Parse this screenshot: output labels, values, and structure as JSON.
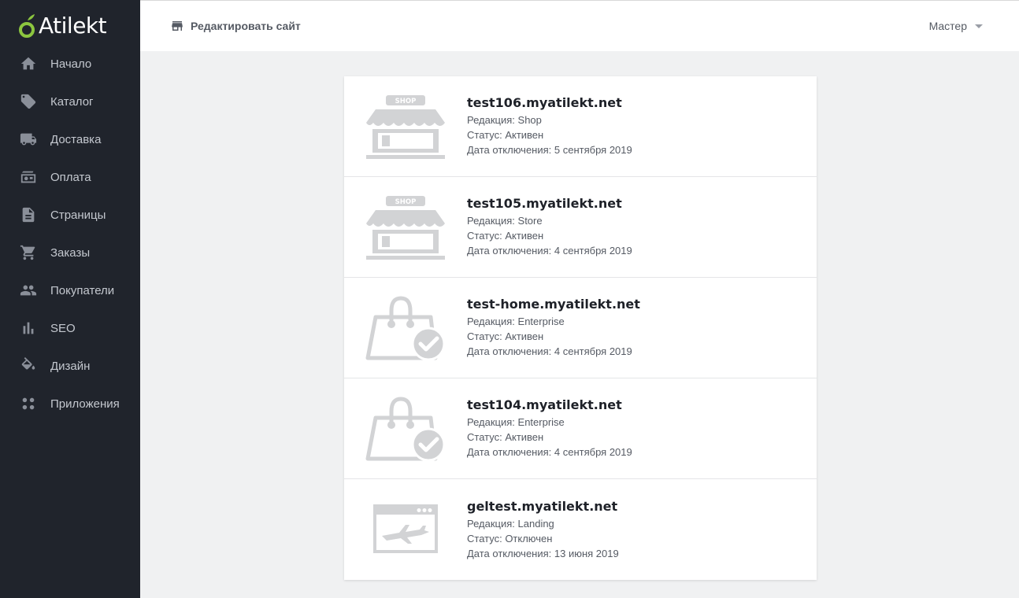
{
  "brand": {
    "name": "Atilekt"
  },
  "sidebar": {
    "items": [
      {
        "label": "Начало",
        "icon": "home-icon"
      },
      {
        "label": "Каталог",
        "icon": "tag-icon"
      },
      {
        "label": "Доставка",
        "icon": "truck-icon"
      },
      {
        "label": "Оплата",
        "icon": "wallet-icon"
      },
      {
        "label": "Страницы",
        "icon": "document-icon"
      },
      {
        "label": "Заказы",
        "icon": "cart-icon"
      },
      {
        "label": "Покупатели",
        "icon": "users-icon"
      },
      {
        "label": "SEO",
        "icon": "bar-chart-icon"
      },
      {
        "label": "Дизайн",
        "icon": "paint-bucket-icon"
      },
      {
        "label": "Приложения",
        "icon": "apps-grid-icon"
      }
    ]
  },
  "topbar": {
    "edit_site_label": "Редактировать сайт",
    "edit_site_icon": "store-icon",
    "user_label": "Мастер"
  },
  "sites": [
    {
      "name": "test106.myatilekt.net",
      "edition": "Редакция: Shop",
      "status": "Статус: Активен",
      "expires": "Дата отключения: 5 сентября 2019",
      "icon": "shop-storefront-icon"
    },
    {
      "name": "test105.myatilekt.net",
      "edition": "Редакция: Store",
      "status": "Статус: Активен",
      "expires": "Дата отключения: 4 сентября 2019",
      "icon": "shop-storefront-icon"
    },
    {
      "name": "test-home.myatilekt.net",
      "edition": "Редакция: Enterprise",
      "status": "Статус: Активен",
      "expires": "Дата отключения: 4 сентября 2019",
      "icon": "shopping-bag-check-icon"
    },
    {
      "name": "test104.myatilekt.net",
      "edition": "Редакция: Enterprise",
      "status": "Статус: Активен",
      "expires": "Дата отключения: 4 сентября 2019",
      "icon": "shopping-bag-check-icon"
    },
    {
      "name": "geltest.myatilekt.net",
      "edition": "Редакция: Landing",
      "status": "Статус: Отключен",
      "expires": "Дата отключения: 13 июня 2019",
      "icon": "landing-browser-plane-icon"
    }
  ],
  "colors": {
    "sidebar_bg": "#20242c",
    "page_bg": "#f0f1f2",
    "logo_green": "#8cc63f",
    "icon_gray": "#d2d3d5"
  }
}
